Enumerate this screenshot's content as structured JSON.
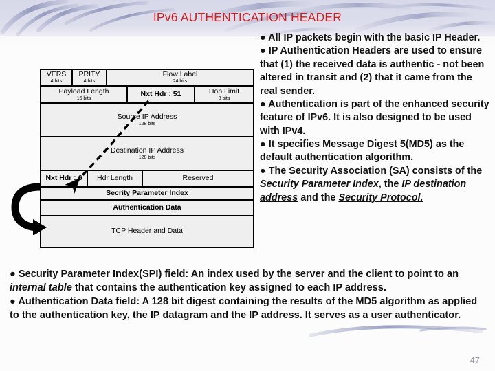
{
  "slide": {
    "title": "IPv6 AUTHENTICATION HEADER",
    "page_number": "47",
    "title_color": "#d61b1b",
    "accent_color": "#a3a6c4"
  },
  "diagram": {
    "name": "ipv6-authentication-header-packet-format",
    "rows": [
      {
        "cells": [
          {
            "label": "VERS",
            "bits": "4 bits"
          },
          {
            "label": "PRITY",
            "bits": "4 bits"
          },
          {
            "label": "Flow Label",
            "bits": "24 bits"
          }
        ]
      },
      {
        "cells": [
          {
            "label": "Payload Length",
            "bits": "16 bits"
          },
          {
            "label": "Nxt Hdr : 51",
            "bits": ""
          },
          {
            "label": "Hop Limit",
            "bits": "8 bits"
          }
        ]
      },
      {
        "cells": [
          {
            "label": "Source IP Address",
            "bits": "128 bits"
          }
        ]
      },
      {
        "cells": [
          {
            "label": "Destination IP  Address",
            "bits": "128 bits"
          }
        ]
      },
      {
        "cells": [
          {
            "label": "Nxt Hdr : 6",
            "bits": ""
          },
          {
            "label": "Hdr Length",
            "bits": ""
          },
          {
            "label": "Reserved",
            "bits": ""
          }
        ]
      },
      {
        "cells": [
          {
            "label": "Secrity Parameter Index",
            "bits": ""
          }
        ]
      },
      {
        "cells": [
          {
            "label": "Authentication Data",
            "bits": ""
          }
        ]
      },
      {
        "cells": [
          {
            "label": "TCP Header and Data",
            "bits": ""
          }
        ]
      }
    ]
  },
  "right_bullets": {
    "b1": "All IP packets begin with the basic IP Header.",
    "b2": "IP Authentication Headers  are used to ensure that (1) the received data is authentic - not been altered in transit and (2) that it came from the real sender.",
    "b3": "Authentication is part of the enhanced security feature of IPv6. It is also designed to be used with IPv4.",
    "b4_pre": "It specifies ",
    "b4_underline": "Message Digest 5(MD5)",
    "b4_post": " as the default authentication algorithm.",
    "b5_pre": "The Security Association (SA) consists of the ",
    "b5_em1": "Security Parameter Index",
    "b5_mid1": ", the ",
    "b5_em2": "IP destination address",
    "b5_mid2": " and the ",
    "b5_em3": "Security Protocol."
  },
  "bottom_bullets": {
    "b1_pre": "Security Parameter Index(SPI) field: An index used by the server and the client to point to an ",
    "b1_em": "internal table",
    "b1_post": " that contains the authentication key assigned to each IP address.",
    "b2": "Authentication Data field: A 128 bit digest containing the results of the MD5 algorithm as applied to the authentication key, the IP datagram and the IP address. It serves as a user authenticator."
  },
  "bullet_glyph": "●"
}
